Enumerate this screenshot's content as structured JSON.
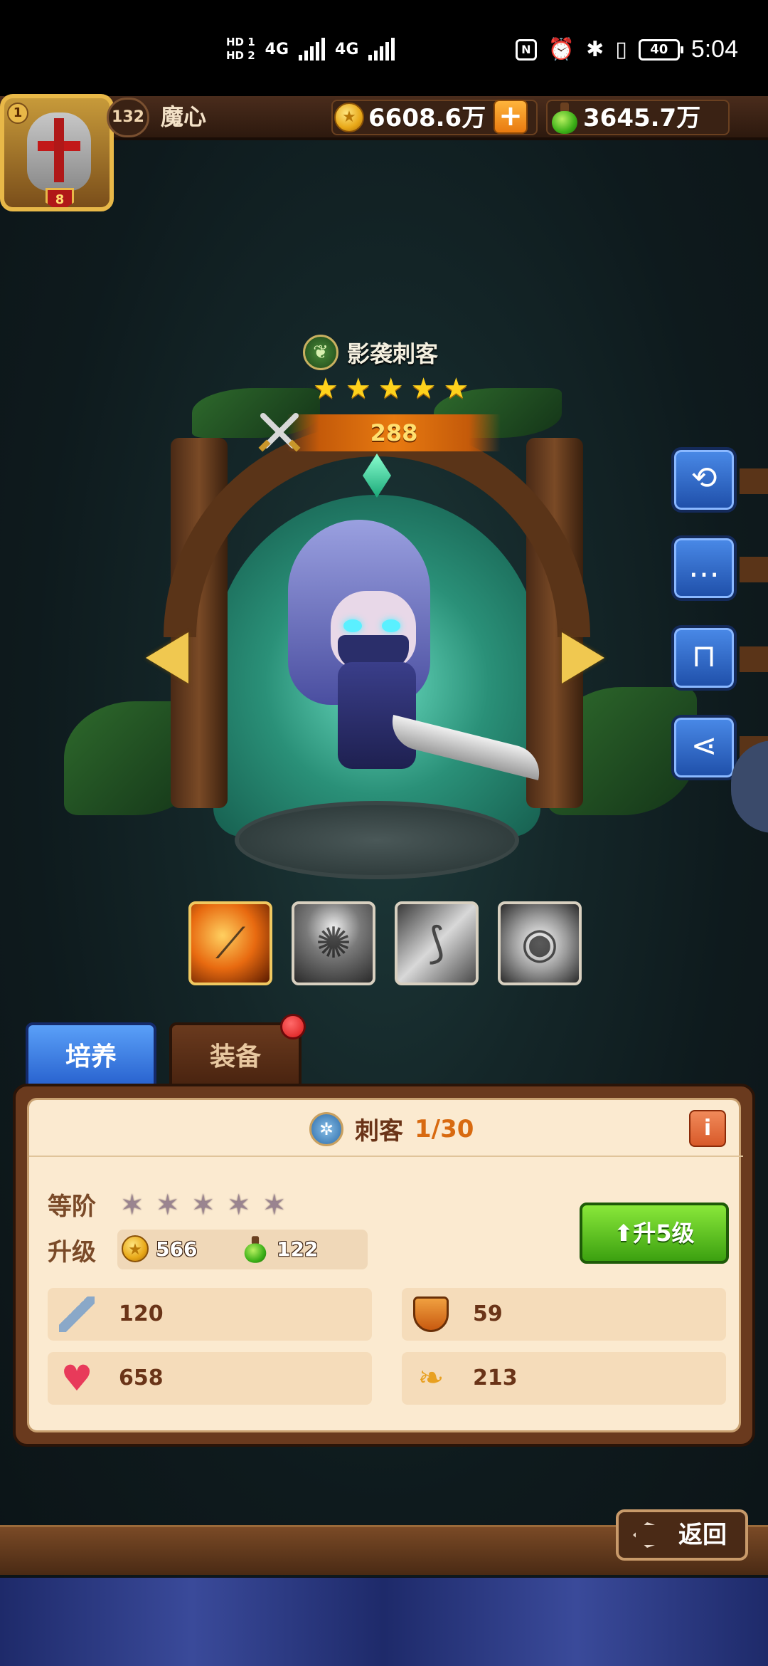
{
  "status_bar": {
    "hd1": "HD 1",
    "hd2": "HD 2",
    "net1": "4G",
    "net2": "4G",
    "nfc": "N",
    "battery": "40",
    "time": "5:04"
  },
  "player": {
    "vip": "1",
    "rank": "8",
    "level": "132",
    "name": "魔心"
  },
  "resources": {
    "gold": "6608.6万",
    "potion": "3645.7万"
  },
  "hero": {
    "name": "影袭刺客",
    "stars": 5,
    "power": "288",
    "element_icon": "leaf-icon"
  },
  "skills": [
    "blade-slash-skill",
    "spirit-strike-skill",
    "axe-blade-skill",
    "eye-vision-skill"
  ],
  "tabs": {
    "train": "培养",
    "equip": "装备"
  },
  "panel": {
    "class_name": "刺客",
    "class_level": "1/30",
    "info": "i",
    "rank_label": "等阶",
    "upgrade_label": "升级",
    "upgrade_gold": "566",
    "upgrade_potion": "122",
    "upgrade_button": "升5级",
    "stats": {
      "attack": "120",
      "defense": "59",
      "hp": "658",
      "speed": "213"
    }
  },
  "back_button": "返回",
  "colors": {
    "accent_blue": "#2a64d0",
    "upgrade_green": "#3ca010",
    "star_gold": "#ffd21c",
    "panel_bg": "#fbead0"
  }
}
